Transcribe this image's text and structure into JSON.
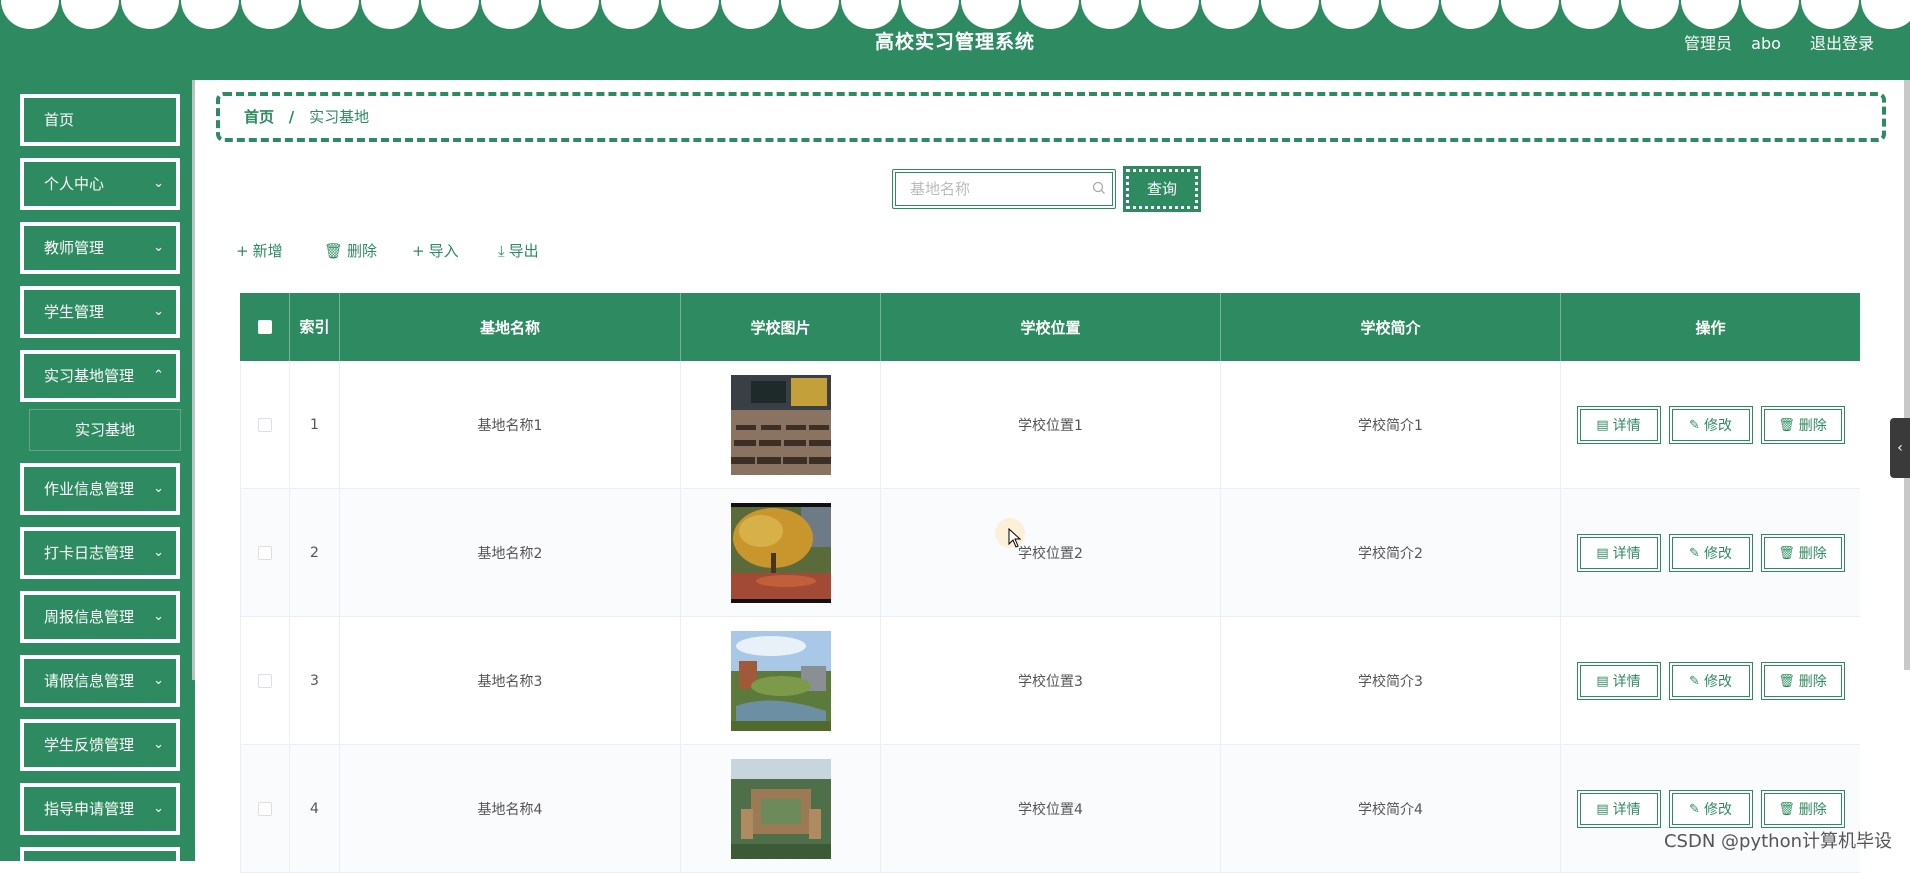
{
  "header": {
    "title": "高校实习管理系统",
    "role": "管理员",
    "username": "abo",
    "logout_label": "退出登录"
  },
  "sidebar": {
    "items": [
      {
        "label": "首页"
      },
      {
        "label": "个人中心"
      },
      {
        "label": "教师管理"
      },
      {
        "label": "学生管理"
      },
      {
        "label": "实习基地管理"
      },
      {
        "label": "作业信息管理"
      },
      {
        "label": "打卡日志管理"
      },
      {
        "label": "周报信息管理"
      },
      {
        "label": "请假信息管理"
      },
      {
        "label": "学生反馈管理"
      },
      {
        "label": "指导申请管理"
      }
    ],
    "submenu": {
      "label": "实习基地"
    }
  },
  "breadcrumb": {
    "home": "首页",
    "separator": "/",
    "current": "实习基地"
  },
  "search": {
    "placeholder": "基地名称",
    "button_label": "查询"
  },
  "actions": {
    "add": "新增",
    "delete": "删除",
    "import": "导入",
    "export": "导出"
  },
  "table": {
    "headers": {
      "index": "索引",
      "name": "基地名称",
      "image": "学校图片",
      "location": "学校位置",
      "intro": "学校简介",
      "ops": "操作"
    },
    "rows": [
      {
        "index": "1",
        "name": "基地名称1",
        "location": "学校位置1",
        "intro": "学校简介1"
      },
      {
        "index": "2",
        "name": "基地名称2",
        "location": "学校位置2",
        "intro": "学校简介2"
      },
      {
        "index": "3",
        "name": "基地名称3",
        "location": "学校位置3",
        "intro": "学校简介3"
      },
      {
        "index": "4",
        "name": "基地名称4",
        "location": "学校位置4",
        "intro": "学校简介4"
      }
    ],
    "op_labels": {
      "detail": "详情",
      "edit": "修改",
      "delete": "删除"
    }
  },
  "watermark": "CSDN @python计算机毕设",
  "colors": {
    "primary": "#2e8b61",
    "white": "#ffffff"
  }
}
